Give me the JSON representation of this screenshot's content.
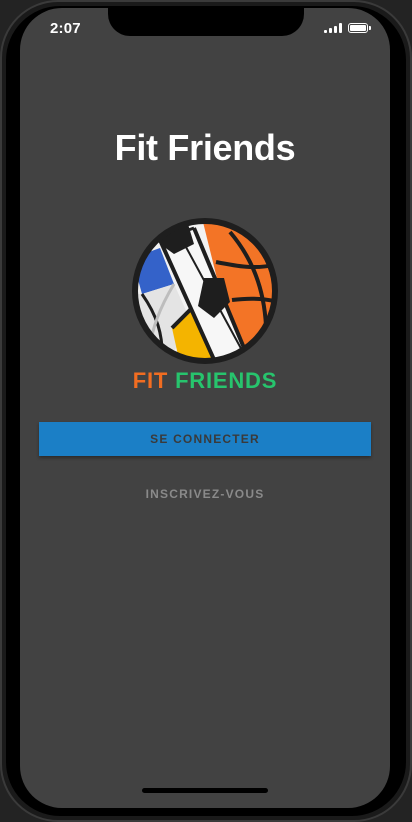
{
  "status_bar": {
    "time": "2:07",
    "signal_icon": "cellular-signal-icon",
    "battery_icon": "battery-icon"
  },
  "app": {
    "title": "Fit Friends"
  },
  "logo": {
    "icon": "sports-ball-logo",
    "brand_part1": "FIT",
    "brand_part2": "FRIENDS"
  },
  "actions": {
    "login_label": "SE CONNECTER",
    "signup_label": "INSCRIVEZ-VOUS"
  },
  "colors": {
    "background": "#424242",
    "primary_button": "#1b7fc6",
    "brand_orange": "#f26d21",
    "brand_green": "#27c46d",
    "secondary_text": "#8a8a8a"
  }
}
